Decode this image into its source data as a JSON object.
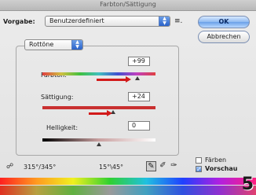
{
  "window": {
    "title": "Farbton/Sättigung"
  },
  "preset": {
    "label": "Vorgabe:",
    "value": "Benutzerdefiniert",
    "menu_glyph": "≡."
  },
  "buttons": {
    "ok": "OK",
    "cancel": "Abbrechen"
  },
  "channel": {
    "value": "Rottöne"
  },
  "sliders": {
    "hue": {
      "label": "Farbton:",
      "value": "+99"
    },
    "saturation": {
      "label": "Sättigung:",
      "value": "+24"
    },
    "lightness": {
      "label": "Helligkeit:",
      "value": "0"
    }
  },
  "range": {
    "left": "315°/345°",
    "right": "15°\\45°"
  },
  "options": {
    "colorize": {
      "label": "Färben",
      "checked": false
    },
    "preview": {
      "label": "Vorschau",
      "checked": true
    }
  },
  "step_number": "5",
  "colors": {
    "accent": "#6aa0e8",
    "arrow": "#d21a1a",
    "saturation_track": "#c93030"
  }
}
